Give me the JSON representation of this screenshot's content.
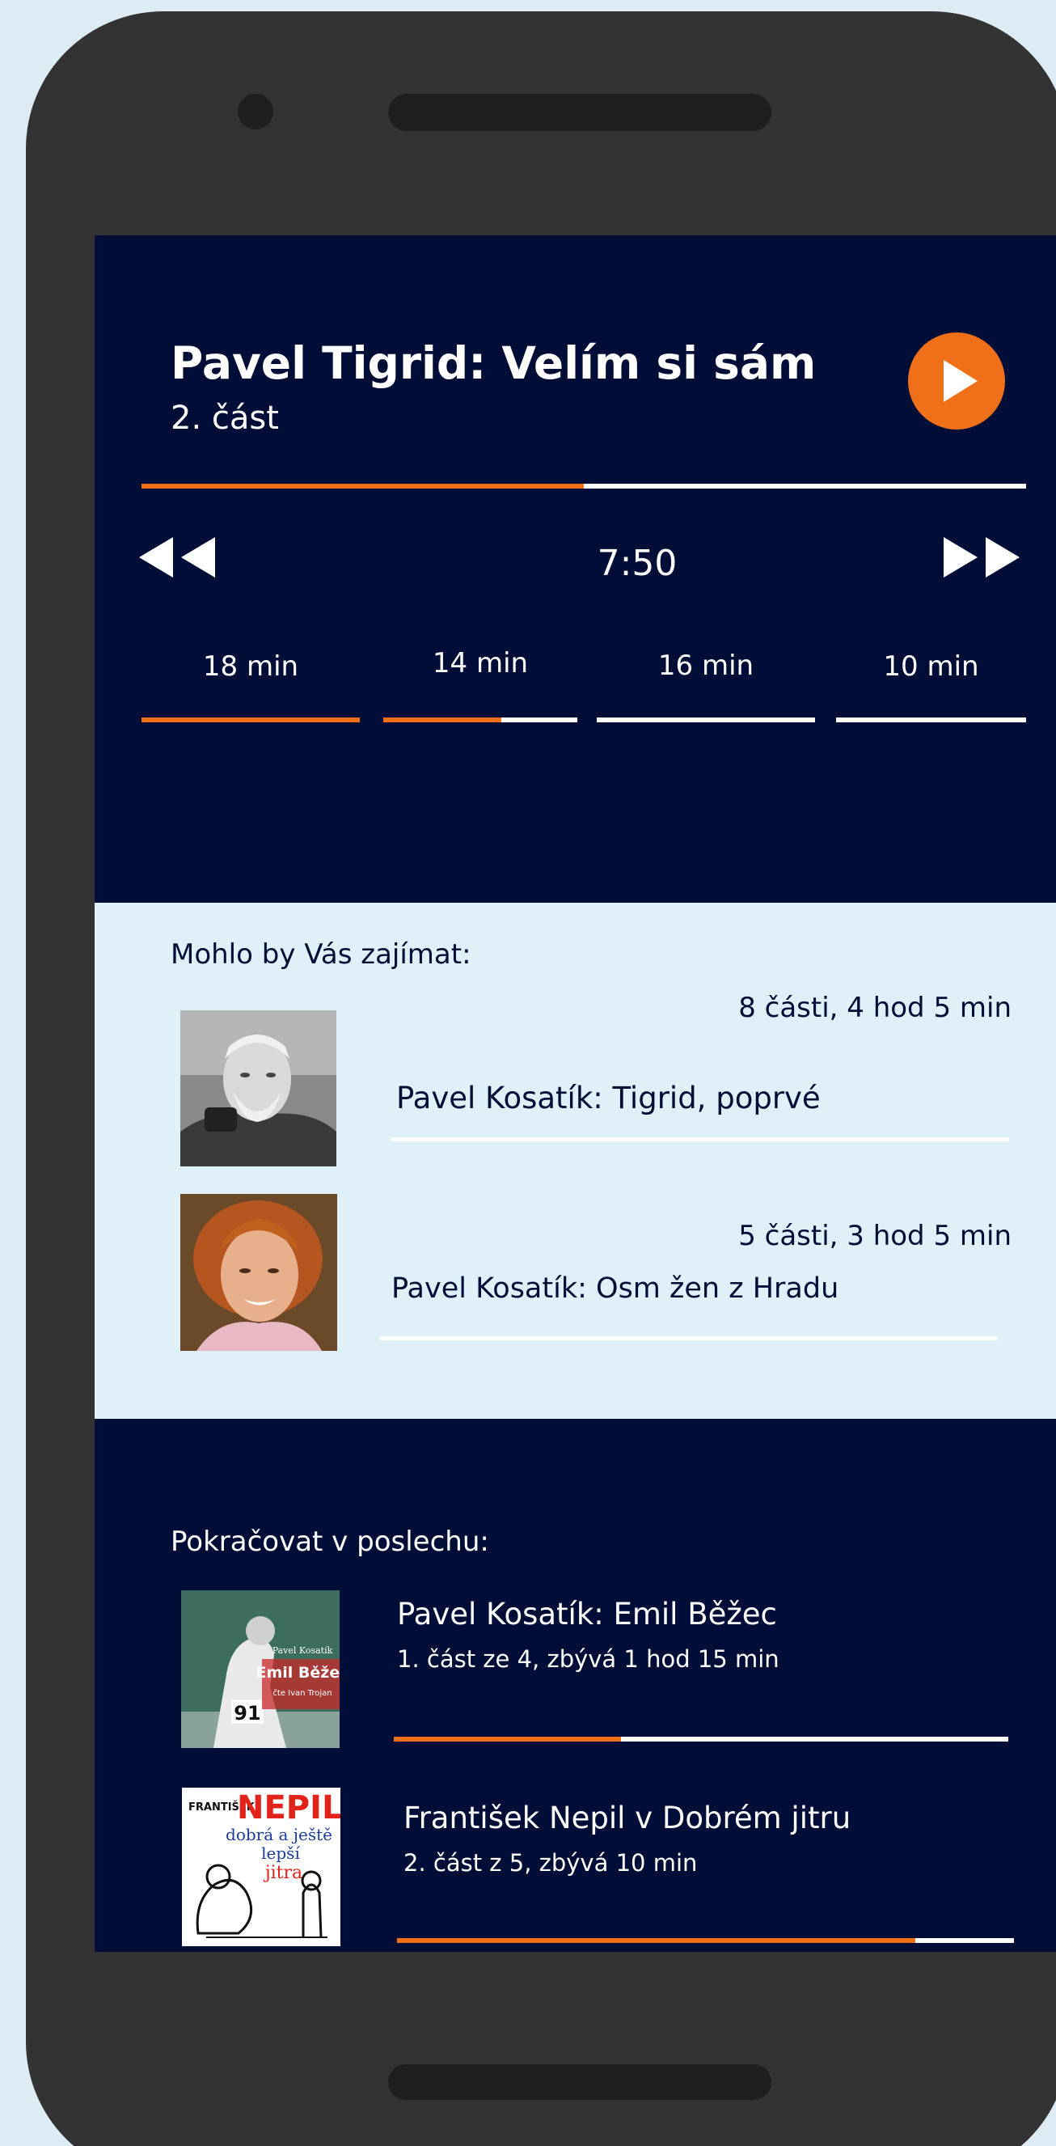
{
  "player": {
    "title": "Pavel Tigrid: Velím si sám",
    "subtitle": "2. část",
    "progress": 0.5,
    "time": "7:50",
    "segments": [
      {
        "label": "18 min",
        "progress": 1.0
      },
      {
        "label": "14 min",
        "progress": 0.61
      },
      {
        "label": "16 min",
        "progress": 0.0
      },
      {
        "label": "10 min",
        "progress": 0.0
      }
    ]
  },
  "suggestions": {
    "heading": "Mohlo by Vás zajímat:",
    "items": [
      {
        "meta": "8 části, 4 hod 5 min",
        "title": "Pavel Kosatík: Tigrid, poprvé"
      },
      {
        "meta": "5 části, 3 hod 5 min",
        "title": "Pavel Kosatík: Osm žen z Hradu"
      }
    ]
  },
  "continue": {
    "heading": "Pokračovat v poslechu:",
    "items": [
      {
        "title": "Pavel Kosatík: Emil Běžec",
        "subtitle": "1. část ze 4, zbývá 1 hod 15  min",
        "progress": 0.37,
        "cover": {
          "author": "Pavel Kosatík",
          "title": "Emil Běžec",
          "reader": "čte Ivan Trojan"
        }
      },
      {
        "title": "František Nepil v Dobrém jitru",
        "subtitle": "2. část z 5, zbývá 10 min",
        "progress": 0.84,
        "cover": {
          "author": "FRANTIŠEK",
          "title": "NEPIL",
          "line1": "dobrá a ještě",
          "line2": "lepší",
          "line3": "jitra"
        }
      }
    ]
  },
  "colors": {
    "navy": "#000d36",
    "accent": "#f07019",
    "light": "#dff0f8",
    "device": "#333333"
  }
}
